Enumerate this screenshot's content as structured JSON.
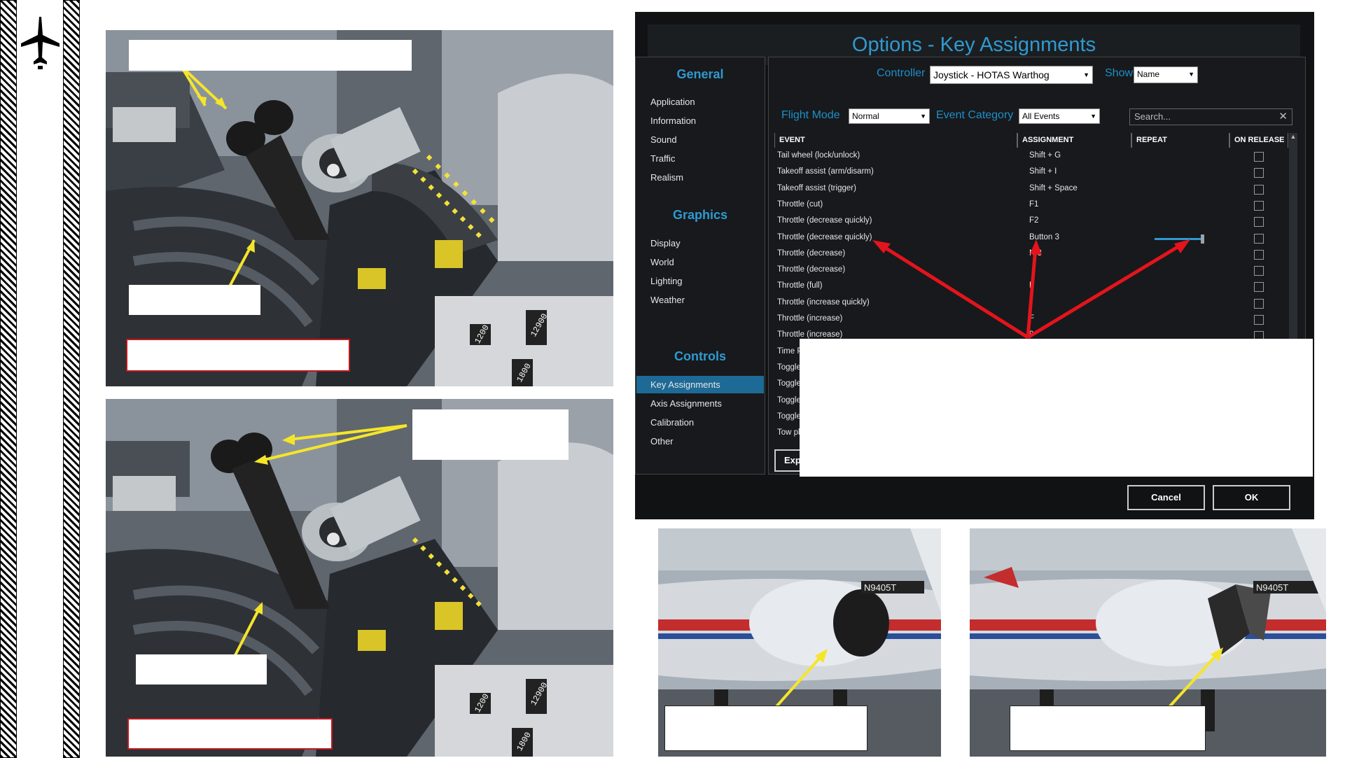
{
  "dialog": {
    "title": "Options - Key Assignments",
    "sidebar": {
      "sections": [
        {
          "header": "General",
          "items": [
            "Application",
            "Information",
            "Sound",
            "Traffic",
            "Realism"
          ]
        },
        {
          "header": "Graphics",
          "items": [
            "Display",
            "World",
            "Lighting",
            "Weather"
          ]
        },
        {
          "header": "Controls",
          "items": [
            "Key Assignments",
            "Axis Assignments",
            "Calibration",
            "Other"
          ]
        }
      ],
      "selected": "Key Assignments"
    },
    "controller_label": "Controller",
    "controller_value": "Joystick - HOTAS Warthog",
    "show_label": "Show",
    "show_value": "Name",
    "flight_mode_label": "Flight Mode",
    "flight_mode_value": "Normal",
    "event_category_label": "Event Category",
    "event_category_value": "All Events",
    "search_placeholder": "Search...",
    "columns": [
      "EVENT",
      "ASSIGNMENT",
      "REPEAT",
      "ON RELEASE"
    ],
    "rows": [
      {
        "event": "Tail wheel (lock/unlock)",
        "assignment": "Shift + G"
      },
      {
        "event": "Takeoff assist (arm/disarm)",
        "assignment": "Shift + I"
      },
      {
        "event": "Takeoff assist (trigger)",
        "assignment": "Shift + Space"
      },
      {
        "event": "Throttle (cut)",
        "assignment": "F1"
      },
      {
        "event": "Throttle (decrease quickly)",
        "assignment": "F2"
      },
      {
        "event": "Throttle (decrease quickly)",
        "assignment": "Button 3"
      },
      {
        "event": "Throttle (decrease)",
        "assignment": "N   3"
      },
      {
        "event": "Throttle (decrease)",
        "assignment": ""
      },
      {
        "event": "Throttle (full)",
        "assignment": "F"
      },
      {
        "event": "Throttle (increase quickly)",
        "assignment": ""
      },
      {
        "event": "Throttle (increase)",
        "assignment": "F"
      },
      {
        "event": "Throttle (increase)",
        "assignment": "9"
      },
      {
        "event": "Time P",
        "assignment": ""
      },
      {
        "event": "Toggle",
        "assignment": ""
      },
      {
        "event": "Toggle",
        "assignment": ""
      },
      {
        "event": "Toggle",
        "assignment": ""
      },
      {
        "event": "Toggle",
        "assignment": ""
      },
      {
        "event": "Tow pl",
        "assignment": ""
      }
    ],
    "repeat_slider_value": 1.0,
    "export_button": "Exp",
    "cancel_button": "Cancel",
    "ok_button": "OK"
  },
  "photos": {
    "display_text": [
      "1200",
      "12900",
      "1800"
    ],
    "registration": "N9405T"
  }
}
